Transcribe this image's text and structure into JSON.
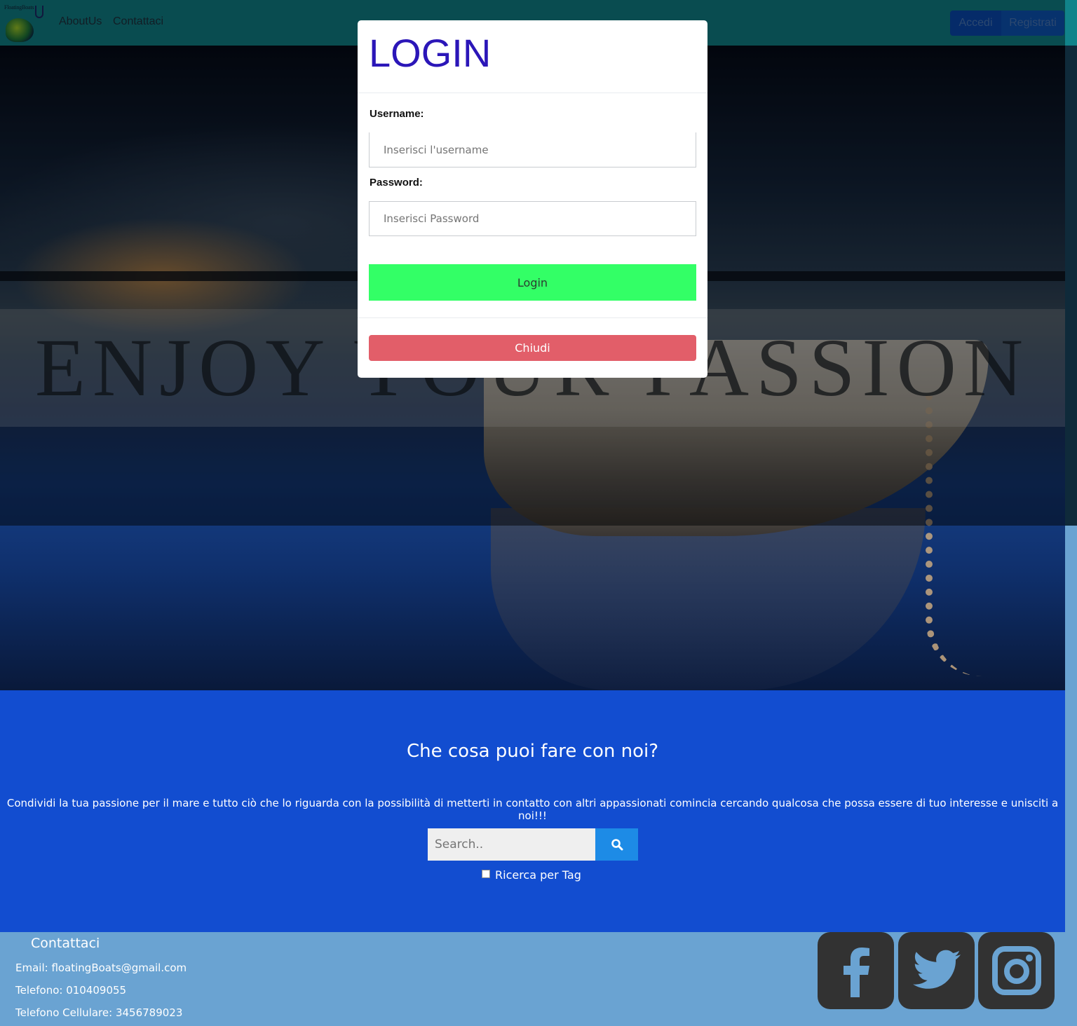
{
  "nav": {
    "logo_text": "FloatingBoats",
    "links": [
      "AboutUs",
      "Contattaci"
    ],
    "buttons": {
      "login": "Accedi",
      "register": "Registrati"
    }
  },
  "hero": {
    "title": "ENJOY YOUR PASSION"
  },
  "modal": {
    "title": "LOGIN",
    "username_label": "Username:",
    "username_placeholder": "Inserisci l'username",
    "password_label": "Password:",
    "password_placeholder": "Inserisci Password",
    "login_button": "Login",
    "close_button": "Chiudi"
  },
  "section": {
    "title": "Che cosa puoi fare con noi?",
    "text": "Condividi la tua passione per il mare e tutto ciò che lo riguarda con la possibilità di metterti in contatto con altri appassionati comincia cercando qualcosa che possa essere di tuo interesse e unisciti a noi!!!",
    "search_placeholder": "Search..",
    "checkbox_label": "Ricerca per Tag"
  },
  "footer": {
    "title": "Contattaci",
    "email": "Email: floatingBoats@gmail.com",
    "phone": "Telefono: 010409055",
    "mobile": "Telefono Cellulare: 3456789023",
    "social_icons": [
      "facebook-icon",
      "twitter-icon",
      "instagram-icon"
    ]
  },
  "colors": {
    "navbar": "#11838a",
    "modal_title": "#2b16b8",
    "login_button": "#33ff66",
    "close_button": "#e25e69",
    "section_bg": "#124dd0",
    "footer_bg": "#6aa3d2",
    "search_button": "#1d8be6"
  }
}
